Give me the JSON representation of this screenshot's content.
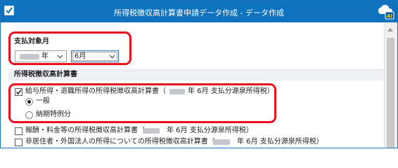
{
  "window": {
    "title": "所得税徴収高計算書申請データ作成 - データ作成",
    "badge": "AI",
    "accent": "#0f72bf",
    "highlight_color": "#e8101c"
  },
  "payment_month": {
    "heading": "支払対象月",
    "year_suffix": "年",
    "month_value": "6月"
  },
  "calc_section": {
    "heading": "所得税徴収高計算書",
    "items": [
      {
        "checked": true,
        "label_before": "給与所得・退職所得の所得税徴収高計算書（",
        "label_after": "年 6月 支払分源泉所得税）"
      },
      {
        "checked": false,
        "label_before": "報酬・料金等の所得税徴収高計算書（",
        "label_after": "年 6月 支払分源泉所得税）"
      },
      {
        "checked": false,
        "label_before": "非居住者・外国法人の所得についての所得税徴収高計算書（",
        "label_after": "年 6月 支払分源泉所得税）"
      }
    ],
    "radio_options": [
      {
        "label": "一般",
        "selected": true
      },
      {
        "label": "納期特例分",
        "selected": false
      }
    ]
  }
}
